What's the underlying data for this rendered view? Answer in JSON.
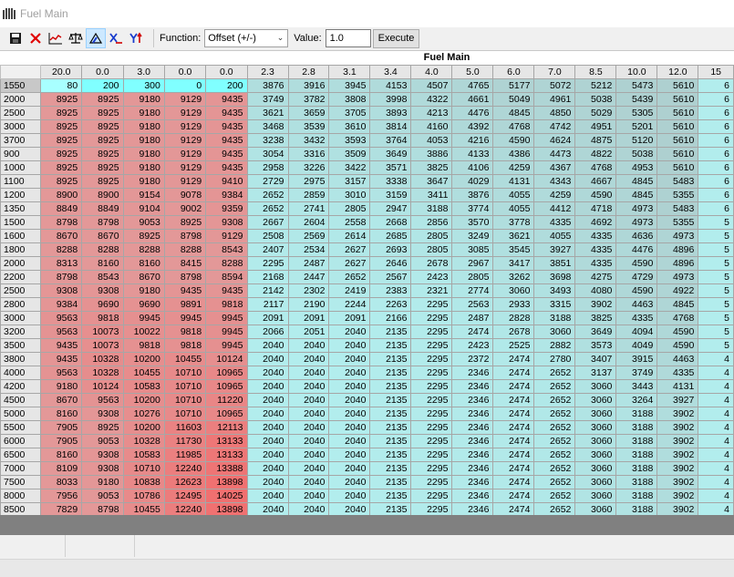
{
  "window": {
    "title": "Fuel Main"
  },
  "toolbar": {
    "function_label": "Function:",
    "function_value": "Offset (+/-)",
    "value_label": "Value:",
    "value": "1.0",
    "execute_label": "Execute",
    "buttons": [
      "save-icon",
      "delete-icon",
      "graph-icon",
      "balance-icon",
      "triangle-axis-icon",
      "x-axis-icon",
      "y-axis-icon"
    ]
  },
  "table": {
    "title": "Fuel Main",
    "columns": [
      "20.0",
      "0.0",
      "3.0",
      "0.0",
      "0.0",
      "2.3",
      "2.8",
      "3.1",
      "3.4",
      "4.0",
      "5.0",
      "6.0",
      "7.0",
      "8.5",
      "10.0",
      "12.0",
      "15"
    ],
    "rows": [
      {
        "rpm": "1550",
        "values": [
          "80",
          "200",
          "300",
          "0",
          "200",
          "3876",
          "3916",
          "3945",
          "4153",
          "4507",
          "4765",
          "5177",
          "5072",
          "5212",
          "5473",
          "5610",
          "6"
        ]
      },
      {
        "rpm": "2000",
        "values": [
          "8925",
          "8925",
          "9180",
          "9129",
          "9435",
          "3749",
          "3782",
          "3808",
          "3998",
          "4322",
          "4661",
          "5049",
          "4961",
          "5038",
          "5439",
          "5610",
          "6"
        ]
      },
      {
        "rpm": "2500",
        "values": [
          "8925",
          "8925",
          "9180",
          "9129",
          "9435",
          "3621",
          "3659",
          "3705",
          "3893",
          "4213",
          "4476",
          "4845",
          "4850",
          "5029",
          "5305",
          "5610",
          "6"
        ]
      },
      {
        "rpm": "3000",
        "values": [
          "8925",
          "8925",
          "9180",
          "9129",
          "9435",
          "3468",
          "3539",
          "3610",
          "3814",
          "4160",
          "4392",
          "4768",
          "4742",
          "4951",
          "5201",
          "5610",
          "6"
        ]
      },
      {
        "rpm": "3700",
        "values": [
          "8925",
          "8925",
          "9180",
          "9129",
          "9435",
          "3238",
          "3432",
          "3593",
          "3764",
          "4053",
          "4216",
          "4590",
          "4624",
          "4875",
          "5120",
          "5610",
          "6"
        ]
      },
      {
        "rpm": "900",
        "values": [
          "8925",
          "8925",
          "9180",
          "9129",
          "9435",
          "3054",
          "3316",
          "3509",
          "3649",
          "3886",
          "4133",
          "4386",
          "4473",
          "4822",
          "5038",
          "5610",
          "6"
        ]
      },
      {
        "rpm": "1000",
        "values": [
          "8925",
          "8925",
          "9180",
          "9129",
          "9435",
          "2958",
          "3226",
          "3422",
          "3571",
          "3825",
          "4106",
          "4259",
          "4367",
          "4768",
          "4953",
          "5610",
          "6"
        ]
      },
      {
        "rpm": "1100",
        "values": [
          "8925",
          "8925",
          "9180",
          "9129",
          "9410",
          "2729",
          "2975",
          "3157",
          "3338",
          "3647",
          "4029",
          "4131",
          "4343",
          "4667",
          "4845",
          "5483",
          "6"
        ]
      },
      {
        "rpm": "1200",
        "values": [
          "8900",
          "8900",
          "9154",
          "9078",
          "9384",
          "2652",
          "2859",
          "3010",
          "3159",
          "3411",
          "3876",
          "4055",
          "4259",
          "4590",
          "4845",
          "5355",
          "6"
        ]
      },
      {
        "rpm": "1350",
        "values": [
          "8849",
          "8849",
          "9104",
          "9002",
          "9359",
          "2652",
          "2741",
          "2805",
          "2947",
          "3188",
          "3774",
          "4055",
          "4412",
          "4718",
          "4973",
          "5483",
          "6"
        ]
      },
      {
        "rpm": "1500",
        "values": [
          "8798",
          "8798",
          "9053",
          "8925",
          "9308",
          "2667",
          "2604",
          "2558",
          "2668",
          "2856",
          "3570",
          "3778",
          "4335",
          "4692",
          "4973",
          "5355",
          "5"
        ]
      },
      {
        "rpm": "1600",
        "values": [
          "8670",
          "8670",
          "8925",
          "8798",
          "9129",
          "2508",
          "2569",
          "2614",
          "2685",
          "2805",
          "3249",
          "3621",
          "4055",
          "4335",
          "4636",
          "4973",
          "5"
        ]
      },
      {
        "rpm": "1800",
        "values": [
          "8288",
          "8288",
          "8288",
          "8288",
          "8543",
          "2407",
          "2534",
          "2627",
          "2693",
          "2805",
          "3085",
          "3545",
          "3927",
          "4335",
          "4476",
          "4896",
          "5"
        ]
      },
      {
        "rpm": "2000",
        "values": [
          "8313",
          "8160",
          "8160",
          "8415",
          "8288",
          "2295",
          "2487",
          "2627",
          "2646",
          "2678",
          "2967",
          "3417",
          "3851",
          "4335",
          "4590",
          "4896",
          "5"
        ]
      },
      {
        "rpm": "2200",
        "values": [
          "8798",
          "8543",
          "8670",
          "8798",
          "8594",
          "2168",
          "2447",
          "2652",
          "2567",
          "2423",
          "2805",
          "3262",
          "3698",
          "4275",
          "4729",
          "4973",
          "5"
        ]
      },
      {
        "rpm": "2500",
        "values": [
          "9308",
          "9308",
          "9180",
          "9435",
          "9435",
          "2142",
          "2302",
          "2419",
          "2383",
          "2321",
          "2774",
          "3060",
          "3493",
          "4080",
          "4590",
          "4922",
          "5"
        ]
      },
      {
        "rpm": "2800",
        "values": [
          "9384",
          "9690",
          "9690",
          "9891",
          "9818",
          "2117",
          "2190",
          "2244",
          "2263",
          "2295",
          "2563",
          "2933",
          "3315",
          "3902",
          "4463",
          "4845",
          "5"
        ]
      },
      {
        "rpm": "3000",
        "values": [
          "9563",
          "9818",
          "9945",
          "9945",
          "9945",
          "2091",
          "2091",
          "2091",
          "2166",
          "2295",
          "2487",
          "2828",
          "3188",
          "3825",
          "4335",
          "4768",
          "5"
        ]
      },
      {
        "rpm": "3200",
        "values": [
          "9563",
          "10073",
          "10022",
          "9818",
          "9945",
          "2066",
          "2051",
          "2040",
          "2135",
          "2295",
          "2474",
          "2678",
          "3060",
          "3649",
          "4094",
          "4590",
          "5"
        ]
      },
      {
        "rpm": "3500",
        "values": [
          "9435",
          "10073",
          "9818",
          "9818",
          "9945",
          "2040",
          "2040",
          "2040",
          "2135",
          "2295",
          "2423",
          "2525",
          "2882",
          "3573",
          "4049",
          "4590",
          "5"
        ]
      },
      {
        "rpm": "3800",
        "values": [
          "9435",
          "10328",
          "10200",
          "10455",
          "10124",
          "2040",
          "2040",
          "2040",
          "2135",
          "2295",
          "2372",
          "2474",
          "2780",
          "3407",
          "3915",
          "4463",
          "4"
        ]
      },
      {
        "rpm": "4000",
        "values": [
          "9563",
          "10328",
          "10455",
          "10710",
          "10965",
          "2040",
          "2040",
          "2040",
          "2135",
          "2295",
          "2346",
          "2474",
          "2652",
          "3137",
          "3749",
          "4335",
          "4"
        ]
      },
      {
        "rpm": "4200",
        "values": [
          "9180",
          "10124",
          "10583",
          "10710",
          "10965",
          "2040",
          "2040",
          "2040",
          "2135",
          "2295",
          "2346",
          "2474",
          "2652",
          "3060",
          "3443",
          "4131",
          "4"
        ]
      },
      {
        "rpm": "4500",
        "values": [
          "8670",
          "9563",
          "10200",
          "10710",
          "11220",
          "2040",
          "2040",
          "2040",
          "2135",
          "2295",
          "2346",
          "2474",
          "2652",
          "3060",
          "3264",
          "3927",
          "4"
        ]
      },
      {
        "rpm": "5000",
        "values": [
          "8160",
          "9308",
          "10276",
          "10710",
          "10965",
          "2040",
          "2040",
          "2040",
          "2135",
          "2295",
          "2346",
          "2474",
          "2652",
          "3060",
          "3188",
          "3902",
          "4"
        ]
      },
      {
        "rpm": "5500",
        "values": [
          "7905",
          "8925",
          "10200",
          "11603",
          "12113",
          "2040",
          "2040",
          "2040",
          "2135",
          "2295",
          "2346",
          "2474",
          "2652",
          "3060",
          "3188",
          "3902",
          "4"
        ]
      },
      {
        "rpm": "6000",
        "values": [
          "7905",
          "9053",
          "10328",
          "11730",
          "13133",
          "2040",
          "2040",
          "2040",
          "2135",
          "2295",
          "2346",
          "2474",
          "2652",
          "3060",
          "3188",
          "3902",
          "4"
        ]
      },
      {
        "rpm": "6500",
        "values": [
          "8160",
          "9308",
          "10583",
          "11985",
          "13133",
          "2040",
          "2040",
          "2040",
          "2135",
          "2295",
          "2346",
          "2474",
          "2652",
          "3060",
          "3188",
          "3902",
          "4"
        ]
      },
      {
        "rpm": "7000",
        "values": [
          "8109",
          "9308",
          "10710",
          "12240",
          "13388",
          "2040",
          "2040",
          "2040",
          "2135",
          "2295",
          "2346",
          "2474",
          "2652",
          "3060",
          "3188",
          "3902",
          "4"
        ]
      },
      {
        "rpm": "7500",
        "values": [
          "8033",
          "9180",
          "10838",
          "12623",
          "13898",
          "2040",
          "2040",
          "2040",
          "2135",
          "2295",
          "2346",
          "2474",
          "2652",
          "3060",
          "3188",
          "3902",
          "4"
        ]
      },
      {
        "rpm": "8000",
        "values": [
          "7956",
          "9053",
          "10786",
          "12495",
          "14025",
          "2040",
          "2040",
          "2040",
          "2135",
          "2295",
          "2346",
          "2474",
          "2652",
          "3060",
          "3188",
          "3902",
          "4"
        ]
      },
      {
        "rpm": "8500",
        "values": [
          "7829",
          "8798",
          "10455",
          "12240",
          "13898",
          "2040",
          "2040",
          "2040",
          "2135",
          "2295",
          "2346",
          "2474",
          "2652",
          "3060",
          "3188",
          "3902",
          "4"
        ]
      }
    ]
  },
  "colors": {
    "row0_cyan": "#80ffff",
    "row0_selected": "#a8ffff",
    "red_low": "#e39898",
    "red_high": "#f07070",
    "teal_low": "#b2eded",
    "teal_high": "#aecece"
  }
}
